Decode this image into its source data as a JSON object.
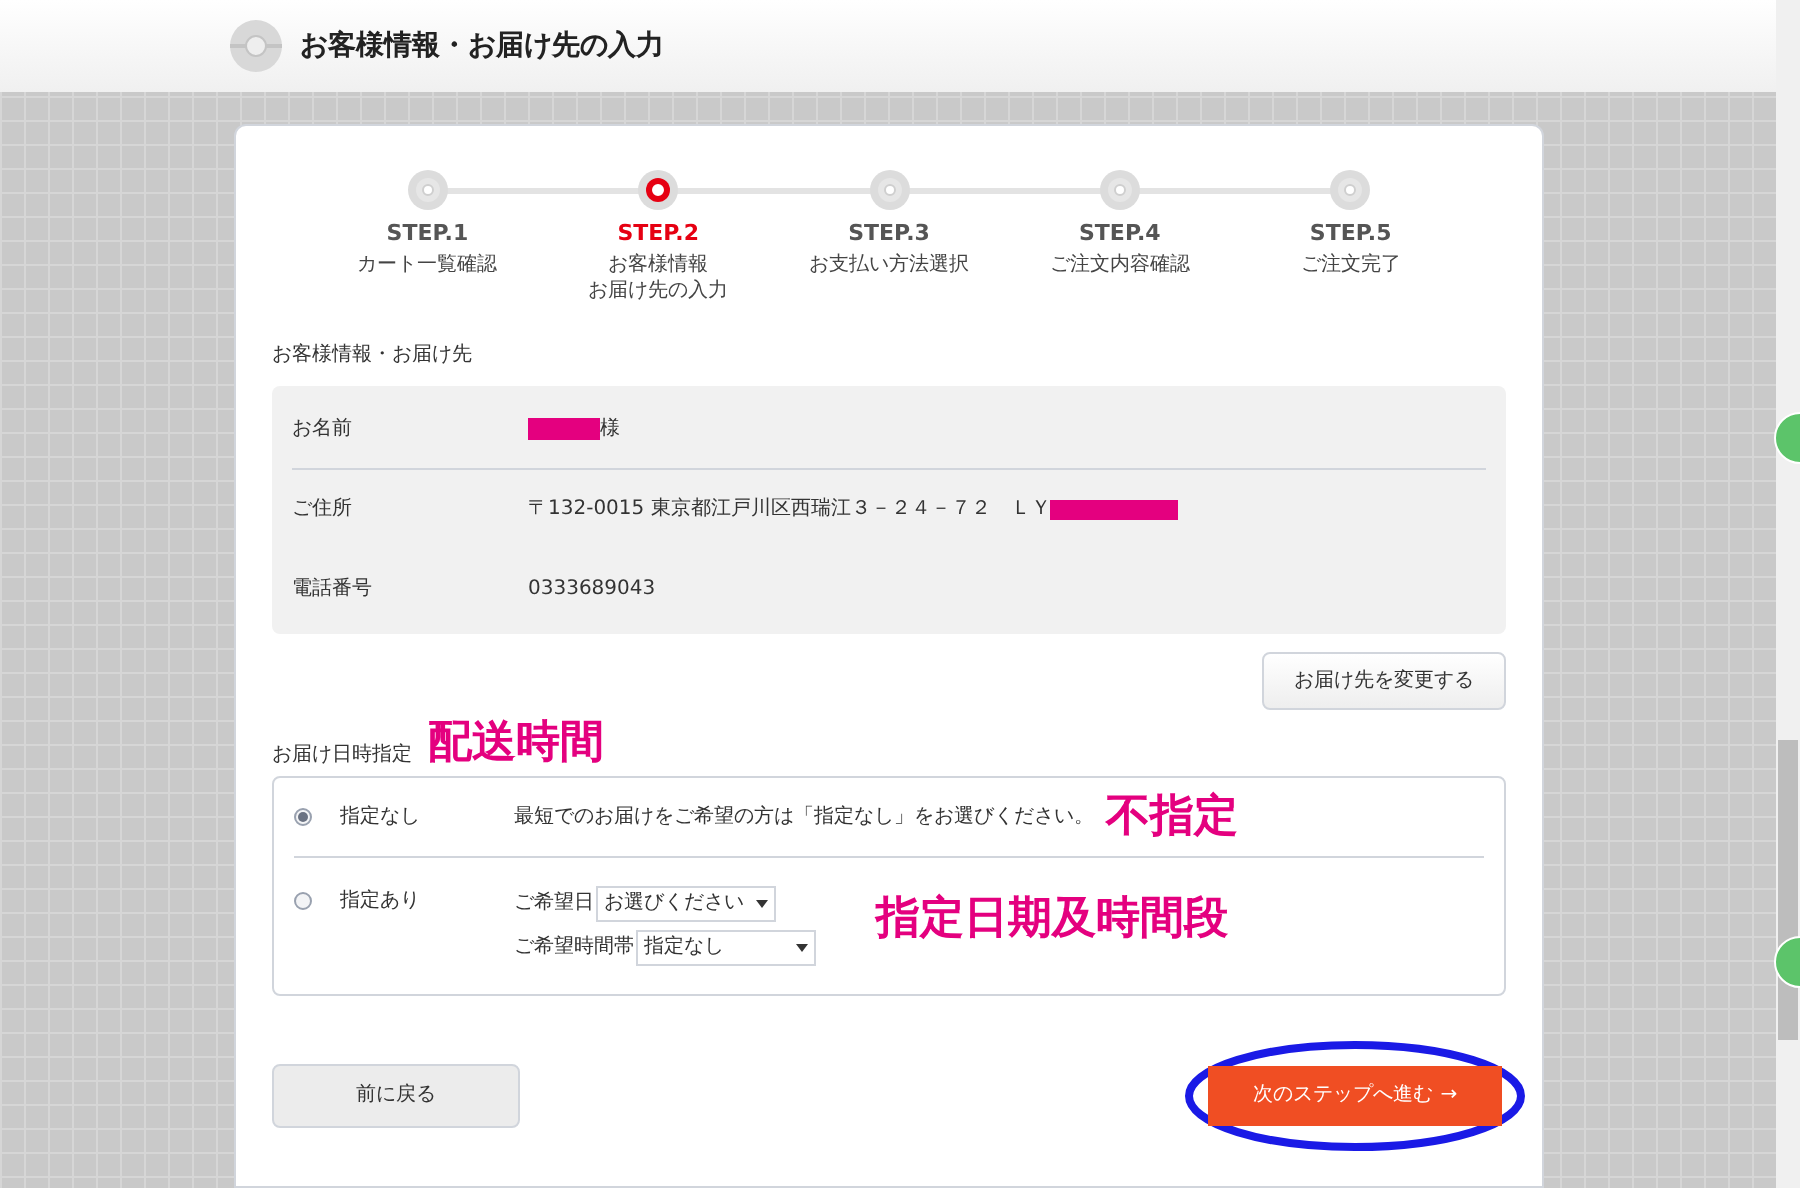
{
  "header": {
    "title": "お客様情報・お届け先の入力"
  },
  "steps": [
    {
      "label": "STEP.1",
      "caption": [
        "カート一覧確認"
      ],
      "selected": false
    },
    {
      "label": "STEP.2",
      "caption": [
        "お客様情報",
        "お届け先の入力"
      ],
      "selected": true
    },
    {
      "label": "STEP.3",
      "caption": [
        "お支払い方法選択"
      ],
      "selected": false
    },
    {
      "label": "STEP.4",
      "caption": [
        "ご注文内容確認"
      ],
      "selected": false
    },
    {
      "label": "STEP.5",
      "caption": [
        "ご注文完了"
      ],
      "selected": false
    }
  ],
  "customer": {
    "heading": "お客様情報・お届け先",
    "rows": [
      {
        "label": "お名前",
        "redacted_before": true,
        "value": "様",
        "redacted_after": false
      },
      {
        "label": "ご住所",
        "redacted_before": false,
        "value": "〒132-0015 東京都江戸川区西瑞江３－２４－７２　ＬＹ",
        "redacted_after": true
      },
      {
        "label": "電話番号",
        "redacted_before": false,
        "value": "0333689043",
        "redacted_after": false
      }
    ],
    "change_button": "お届け先を変更する"
  },
  "delivery": {
    "heading": "お届け日時指定",
    "annotation": "配送時間",
    "options": [
      {
        "kind": "note",
        "label": "指定なし",
        "selected": true,
        "note": "最短でのお届けをご希望の方は「指定なし」をお選びください。",
        "annotation": "不指定"
      },
      {
        "kind": "selects",
        "label": "指定あり",
        "selected": false,
        "fields": [
          {
            "label": "ご希望日",
            "value": "お選びください"
          },
          {
            "label": "ご希望時間帯",
            "value": "指定なし"
          }
        ],
        "annotation": "指定日期及時間段"
      }
    ]
  },
  "buttons": {
    "back": "前に戻る",
    "next": "次のステップへ進む",
    "next_arrow": "→",
    "next_highlighted": true
  }
}
